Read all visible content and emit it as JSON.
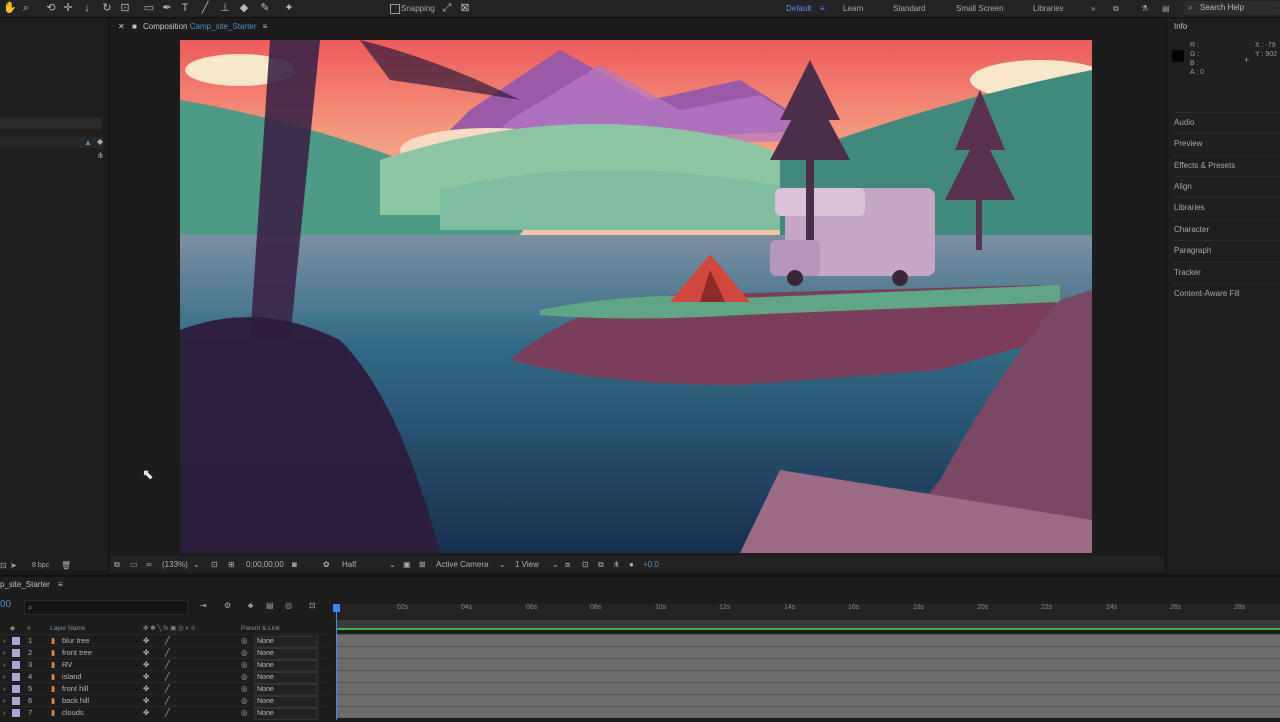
{
  "toolbar": {
    "snapping_label": "Snapping",
    "workspaces": [
      "Default",
      "Learn",
      "Standard",
      "Small Screen",
      "Libraries"
    ],
    "search_placeholder": "Search Help"
  },
  "composition": {
    "tab_prefix": "Composition",
    "tab_name": "Camp_site_Starter",
    "zoom": "(133%)",
    "timecode": "0;00;00;00",
    "resolution": "Half",
    "camera": "Active Camera",
    "views": "1 View",
    "exposure": "+0.0"
  },
  "project": {
    "bit_depth": "8 bpc"
  },
  "info_panel": {
    "title": "Info",
    "r": "R :",
    "g": "G :",
    "b": "B :",
    "a": "A :  0",
    "x": "X : -79",
    "y": "Y : 902"
  },
  "right_panel": {
    "items": [
      "Audio",
      "Preview",
      "Effects & Presets",
      "Align",
      "Libraries",
      "Character",
      "Paragraph",
      "Tracker",
      "Content-Aware Fill"
    ]
  },
  "timeline": {
    "tab_label": "p_site_Starter",
    "current_time": "00",
    "col_num": "#",
    "col_layer_name": "Layer Name",
    "col_parent": "Parent & Link",
    "ticks": [
      "02s",
      "04s",
      "06s",
      "08s",
      "10s",
      "12s",
      "14s",
      "16s",
      "18s",
      "20s",
      "22s",
      "24s",
      "26s",
      "28s"
    ],
    "layers": [
      {
        "num": "1",
        "name": "blur tree",
        "parent": "None",
        "color": "#a7a7d8"
      },
      {
        "num": "2",
        "name": "front tree",
        "parent": "None",
        "color": "#a7a7d8"
      },
      {
        "num": "3",
        "name": "RV",
        "parent": "None",
        "color": "#a7a7d8"
      },
      {
        "num": "4",
        "name": "island",
        "parent": "None",
        "color": "#a7a7d8"
      },
      {
        "num": "5",
        "name": "front hill",
        "parent": "None",
        "color": "#a7a7d8"
      },
      {
        "num": "6",
        "name": "back hill",
        "parent": "None",
        "color": "#a7a7d8"
      },
      {
        "num": "7",
        "name": "clouds",
        "parent": "None",
        "color": "#a7a7d8"
      }
    ]
  },
  "colors": {
    "accent": "#3c86ff",
    "layer_bar": "#6c6c6c"
  }
}
